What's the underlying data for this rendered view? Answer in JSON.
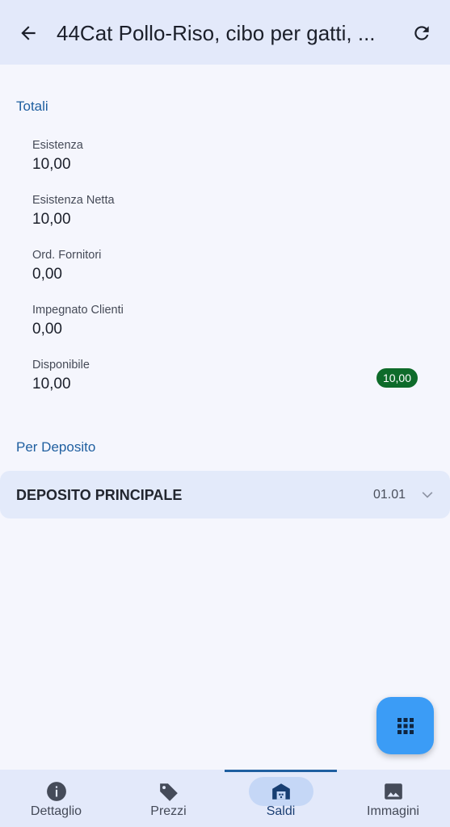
{
  "header": {
    "title": "44Cat Pollo-Riso, cibo per gatti, ..."
  },
  "sections": {
    "totals_title": "Totali",
    "per_deposit_title": "Per Deposito"
  },
  "metrics": [
    {
      "label": "Esistenza",
      "value": "10,00"
    },
    {
      "label": "Esistenza Netta",
      "value": "10,00"
    },
    {
      "label": "Ord. Fornitori",
      "value": "0,00"
    },
    {
      "label": "Impegnato Clienti",
      "value": "0,00"
    },
    {
      "label": "Disponibile",
      "value": "10,00"
    }
  ],
  "available_badge": "10,00",
  "deposit": {
    "name": "DEPOSITO PRINCIPALE",
    "code": "01.01"
  },
  "nav": [
    {
      "label": "Dettaglio",
      "icon": "info-icon"
    },
    {
      "label": "Prezzi",
      "icon": "tag-icon"
    },
    {
      "label": "Saldi",
      "icon": "warehouse-icon",
      "active": true
    },
    {
      "label": "Immagini",
      "icon": "image-icon"
    }
  ],
  "colors": {
    "accent": "#1f5fa0",
    "fab": "#3b9cf6",
    "badge": "#0e6b2a",
    "appbar": "#e3e9fa"
  }
}
